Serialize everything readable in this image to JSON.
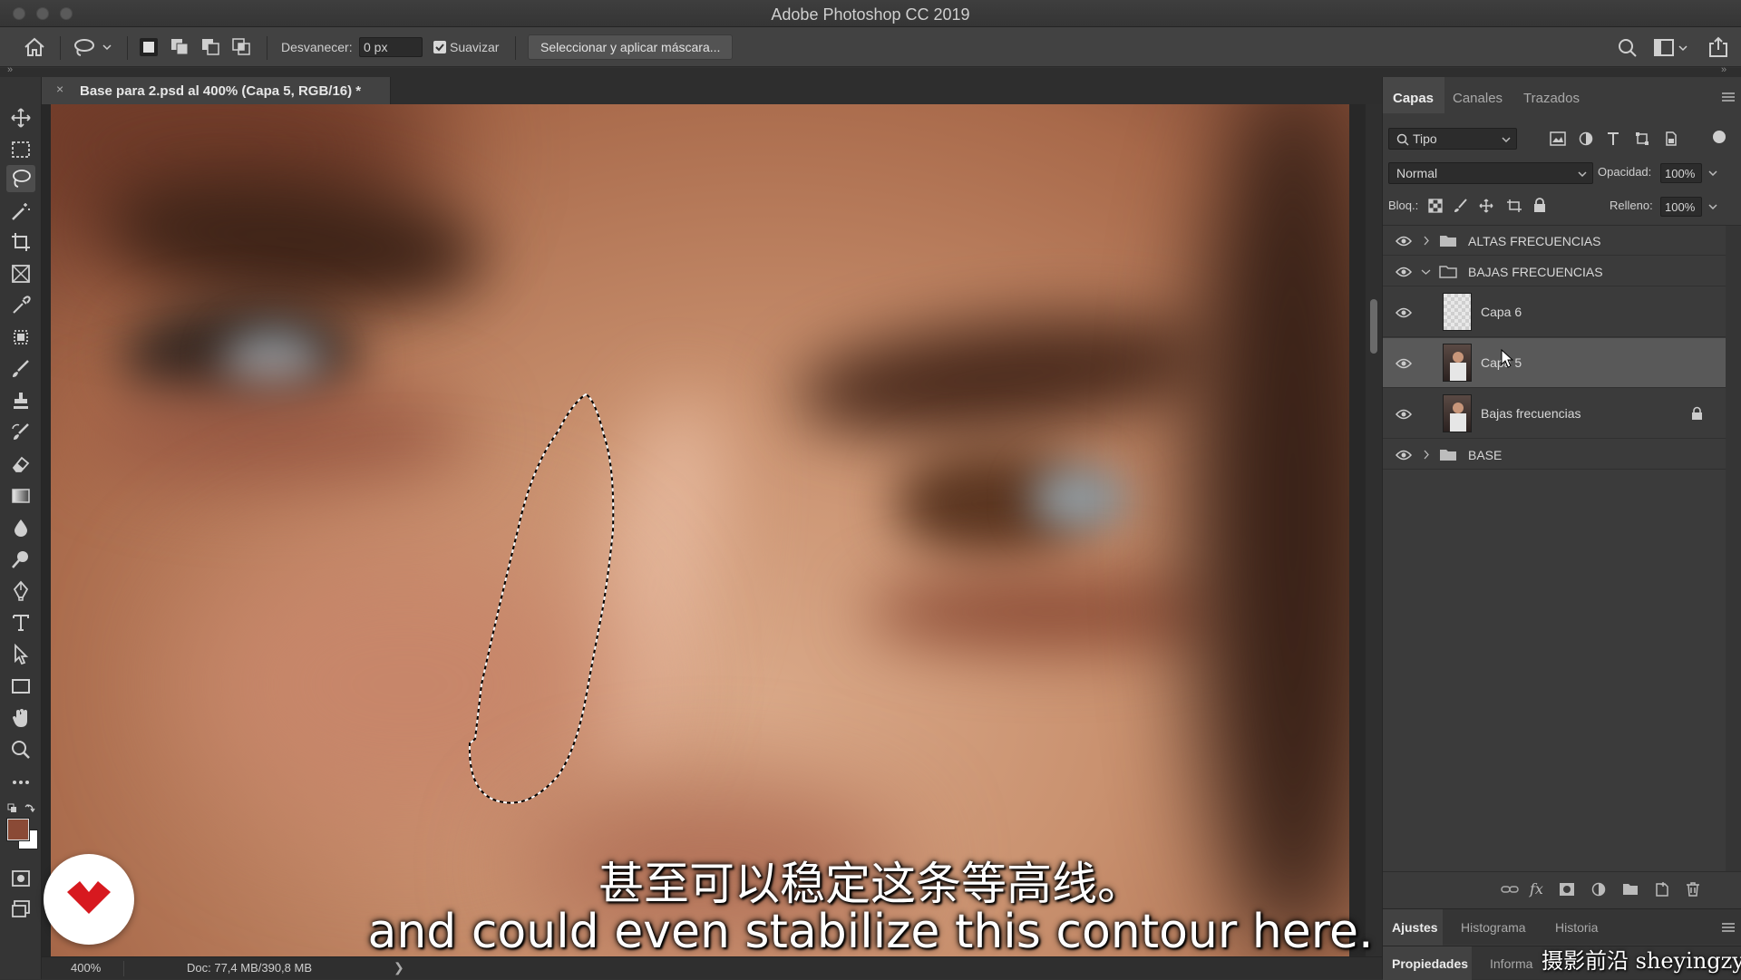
{
  "window": {
    "title": "Adobe Photoshop CC 2019"
  },
  "options_bar": {
    "feather_label": "Desvanecer:",
    "feather_value": "0 px",
    "antialias_label": "Suavizar",
    "antialias_checked": true,
    "mask_button": "Seleccionar y aplicar máscara..."
  },
  "document": {
    "tab_title": "Base para 2.psd al 400% (Capa 5, RGB/16) *",
    "close_glyph": "×"
  },
  "status": {
    "zoom": "400%",
    "doc_size": "Doc: 77,4 MB/390,8 MB",
    "arrow": "❯"
  },
  "layers_panel": {
    "tabs": [
      "Capas",
      "Canales",
      "Trazados"
    ],
    "active_tab": "Capas",
    "filter_kind": "Tipo",
    "blend_mode": "Normal",
    "opacity_label": "Opacidad:",
    "opacity_value": "100%",
    "lock_label": "Bloq.:",
    "fill_label": "Relleno:",
    "fill_value": "100%",
    "layers": [
      {
        "name": "ALTAS FRECUENCIAS",
        "type": "group",
        "expanded": false
      },
      {
        "name": "BAJAS FRECUENCIAS",
        "type": "group",
        "expanded": true
      },
      {
        "name": "Capa 6",
        "type": "layer",
        "selected": false
      },
      {
        "name": "Capa 5",
        "type": "layer",
        "selected": true
      },
      {
        "name": "Bajas frecuencias",
        "type": "layer",
        "locked": true
      },
      {
        "name": "BASE",
        "type": "group",
        "expanded": false
      }
    ]
  },
  "adjust_panel": {
    "tabs": [
      "Ajustes",
      "Histograma",
      "Historia"
    ],
    "active_tab": "Ajustes"
  },
  "props_panel": {
    "tabs": [
      "Propiedades",
      "Informa"
    ],
    "active_tab": "Propiedades"
  },
  "overlay": {
    "subtitle_cn": "甚至可以稳定这条等高线。",
    "subtitle_en": "and could even stabilize this contour here.",
    "watermark": "摄影前沿 sheyingzyz.com"
  },
  "colors": {
    "foreground": "#8a4a36",
    "background": "#ffffff",
    "logo_red": "#d7191f",
    "selection_row": "#595959"
  }
}
